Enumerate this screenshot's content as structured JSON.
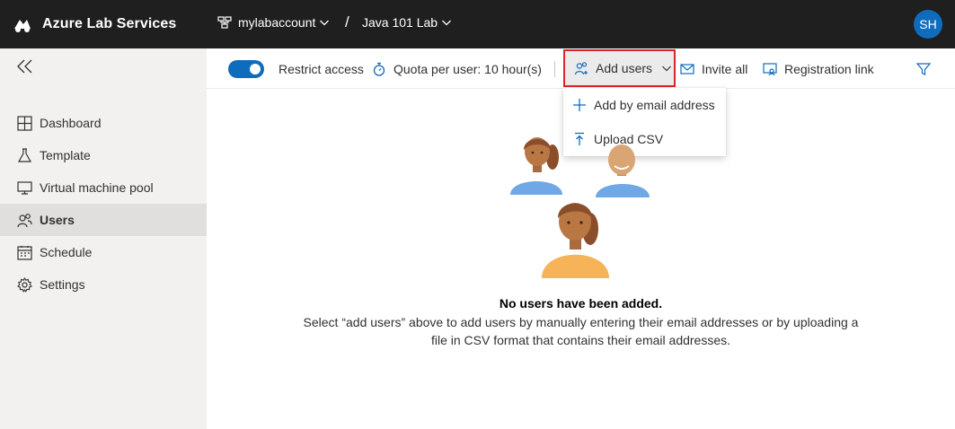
{
  "header": {
    "app_name": "Azure Lab Services",
    "account": "mylabaccount",
    "separator": "/",
    "lab": "Java 101 Lab",
    "avatar_initials": "SH"
  },
  "sidebar": {
    "items": [
      {
        "label": "Dashboard",
        "icon": "dashboard-icon"
      },
      {
        "label": "Template",
        "icon": "flask-icon"
      },
      {
        "label": "Virtual machine pool",
        "icon": "monitor-icon"
      },
      {
        "label": "Users",
        "icon": "users-icon",
        "active": true
      },
      {
        "label": "Schedule",
        "icon": "calendar-icon"
      },
      {
        "label": "Settings",
        "icon": "gear-icon"
      }
    ]
  },
  "toolbar": {
    "restrict_access_label": "Restrict access",
    "restrict_access_on": true,
    "quota_label": "Quota per user: 10 hour(s)",
    "add_users_label": "Add users",
    "invite_all_label": "Invite all",
    "registration_link_label": "Registration link"
  },
  "add_users_menu": {
    "items": [
      {
        "label": "Add by email address",
        "icon": "plus-icon"
      },
      {
        "label": "Upload CSV",
        "icon": "upload-icon"
      }
    ]
  },
  "empty_state": {
    "title": "No users have been added.",
    "description": "Select “add users” above to add users by manually entering their email addresses or by uploading a file in CSV format that contains their email addresses."
  },
  "colors": {
    "accent": "#0f6cbd",
    "topbar": "#1f1f1f",
    "sidebar": "#f2f1f0",
    "highlight_border": "#d9262c"
  }
}
